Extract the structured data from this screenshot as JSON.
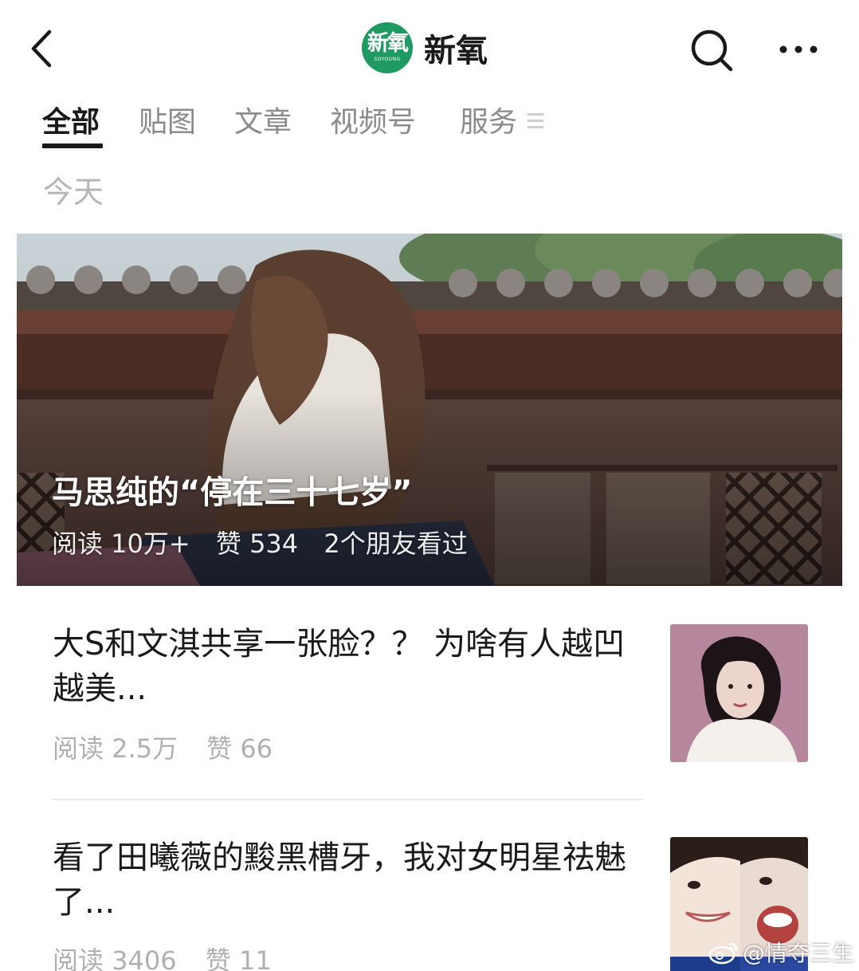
{
  "header": {
    "brand_logo_text": "新氧",
    "brand_logo_sub": "SOYOUNG",
    "brand_name": "新氧"
  },
  "tabs": [
    {
      "label": "全部",
      "active": true
    },
    {
      "label": "贴图",
      "active": false
    },
    {
      "label": "文章",
      "active": false
    },
    {
      "label": "视频号",
      "active": false
    },
    {
      "label": "服务",
      "active": false
    }
  ],
  "date_label": "今天",
  "feature": {
    "title": "马思纯的“停在三十七岁”",
    "reads": "阅读 10万+",
    "likes": "赞 534",
    "friends": "2个朋友看过"
  },
  "articles": [
    {
      "title": "大S和文淇共享一张脸？？ 为啥有人越凹越美...",
      "reads": "阅读 2.5万",
      "likes": "赞 66"
    },
    {
      "title": "看了田曦薇的黢黑槽牙，我对女明星祛魅了...",
      "reads": "阅读 3406",
      "likes": "赞 11"
    }
  ],
  "watermark": "@情夺三生",
  "colors": {
    "brand_green": "#1f9a63",
    "text_primary": "#1a1a1a",
    "text_secondary": "#8a8a8a",
    "meta_gray": "#b0b0b0"
  },
  "icons": {
    "back": "chevron-left-icon",
    "search": "search-icon",
    "more": "more-dots-icon",
    "watermark": "weibo-icon"
  }
}
